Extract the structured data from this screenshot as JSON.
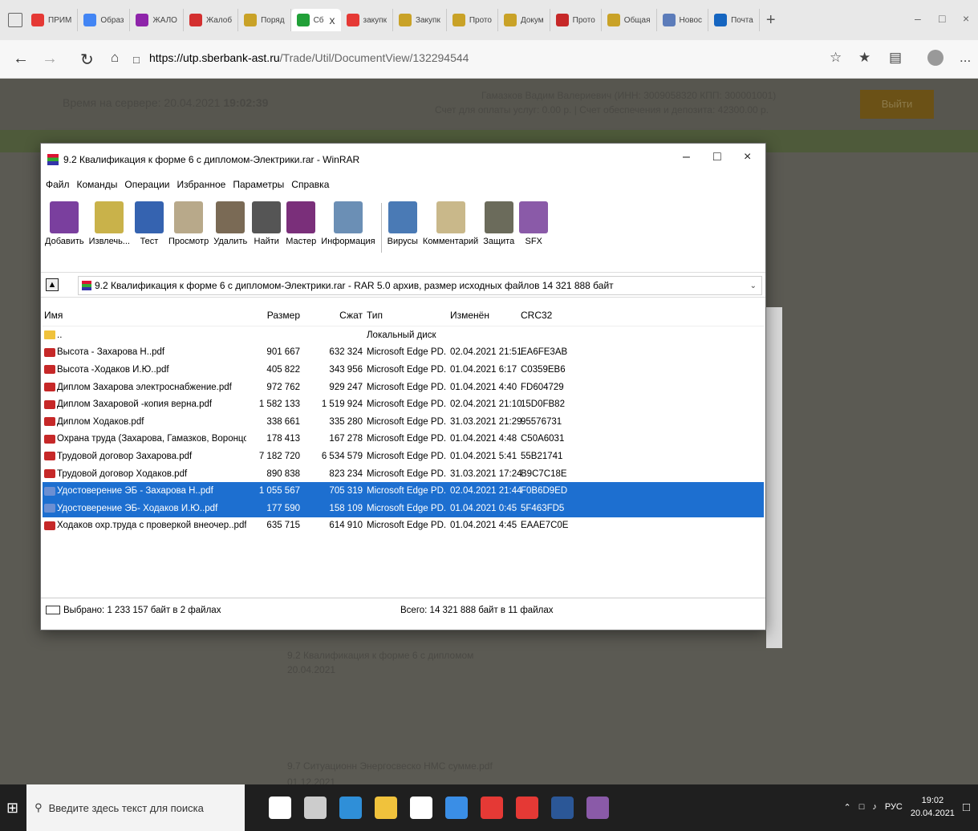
{
  "browser": {
    "tabs": [
      {
        "label": "ПРИМ",
        "favicon_color": "#e53935",
        "active": false
      },
      {
        "label": "Образ",
        "favicon_color": "#4285f4",
        "active": false
      },
      {
        "label": "ЖАЛО",
        "favicon_color": "#8e24aa",
        "active": false
      },
      {
        "label": "Жалоб",
        "favicon_color": "#d32f2f",
        "active": false
      },
      {
        "label": "Поряд",
        "favicon_color": "#c9a227",
        "active": false
      },
      {
        "label": "Сб",
        "favicon_color": "#21a038",
        "active": true,
        "close": "x"
      },
      {
        "label": "закупк",
        "favicon_color": "#e53935",
        "active": false
      },
      {
        "label": "Закупк",
        "favicon_color": "#c9a227",
        "active": false
      },
      {
        "label": "Прото",
        "favicon_color": "#c9a227",
        "active": false
      },
      {
        "label": "Докум",
        "favicon_color": "#c9a227",
        "active": false
      },
      {
        "label": "Прото",
        "favicon_color": "#c62828",
        "active": false
      },
      {
        "label": "Общая",
        "favicon_color": "#c9a227",
        "active": false
      },
      {
        "label": "Новос",
        "favicon_color": "#5c7cba",
        "active": false
      },
      {
        "label": "Почта",
        "favicon_color": "#1565c0",
        "active": false
      }
    ],
    "new_tab": "+",
    "url_scheme_host": "https://utp.sberbank-ast.ru",
    "url_path": "/Trade/Util/DocumentView/132294544",
    "more": "..."
  },
  "page_bg": {
    "server_time_label": "Время на сервере: 20.04.2021 ",
    "server_time_value": "19:02:39",
    "user_line": "Гамазков Вадим Валериевич (ИНН: 3009058320 КПП: 300001001)",
    "account_line": "Счет для оплаты услуг: 0.00 р. | Счет обеспечения и депозита: 42300.00 р.",
    "logout": "Выйти",
    "doc1_title": "9.2 Квалификация к форме 6 с дипломом",
    "doc1_date": "20.04.2021",
    "doc2_title": "9.7 Ситуационн Энергосвеско НМС сумме.pdf",
    "doc2_date": "01.12.2021"
  },
  "winrar": {
    "title": "9.2 Квалификация к форме 6 с дипломом-Электрики.rar - WinRAR",
    "menu": [
      "Файл",
      "Команды",
      "Операции",
      "Избранное",
      "Параметры",
      "Справка"
    ],
    "toolbar": [
      {
        "label": "Добавить",
        "icon": "add-archive-icon",
        "color": "#7a3f9e"
      },
      {
        "label": "Извлечь...",
        "icon": "extract-icon",
        "color": "#c9b24a"
      },
      {
        "label": "Тест",
        "icon": "test-icon",
        "color": "#3563b0"
      },
      {
        "label": "Просмотр",
        "icon": "view-icon",
        "color": "#b8a98a"
      },
      {
        "label": "Удалить",
        "icon": "delete-icon",
        "color": "#7a6a55"
      },
      {
        "label": "Найти",
        "icon": "find-icon",
        "color": "#555555"
      },
      {
        "label": "Мастер",
        "icon": "wizard-icon",
        "color": "#7a2f7a"
      },
      {
        "label": "Информация",
        "icon": "info-icon",
        "color": "#6b8fb5"
      },
      {
        "label": "Вирусы",
        "icon": "virus-scan-icon",
        "color": "#4a7ab5"
      },
      {
        "label": "Комментарий",
        "icon": "comment-icon",
        "color": "#c9b88a"
      },
      {
        "label": "Защита",
        "icon": "protect-icon",
        "color": "#6b6b5b"
      },
      {
        "label": "SFX",
        "icon": "sfx-icon",
        "color": "#8a5aa8"
      }
    ],
    "path_text": "9.2 Квалификация к форме 6 с дипломом-Электрики.rar - RAR 5.0 архив, размер исходных файлов 14 321 888 байт",
    "columns": {
      "name": "Имя",
      "size": "Размер",
      "packed": "Сжат",
      "type": "Тип",
      "modified": "Изменён",
      "crc": "CRC32"
    },
    "files": [
      {
        "name": "..",
        "size": "",
        "packed": "",
        "type": "Локальный диск",
        "modified": "",
        "crc": "",
        "kind": "folder",
        "selected": false
      },
      {
        "name": "Высота - Захарова Н..pdf",
        "size": "901 667",
        "packed": "632 324",
        "type": "Microsoft Edge PD...",
        "modified": "02.04.2021 21:51",
        "crc": "EA6FE3AB",
        "kind": "pdf",
        "selected": false
      },
      {
        "name": "Высота -Ходаков И.Ю..pdf",
        "size": "405 822",
        "packed": "343 956",
        "type": "Microsoft Edge PD...",
        "modified": "01.04.2021 6:17",
        "crc": "C0359EB6",
        "kind": "pdf",
        "selected": false
      },
      {
        "name": "Диплом Захарова электроснабжение.pdf",
        "size": "972 762",
        "packed": "929 247",
        "type": "Microsoft Edge PD...",
        "modified": "01.04.2021 4:40",
        "crc": "FD604729",
        "kind": "pdf",
        "selected": false
      },
      {
        "name": "Диплом Захаровой -копия верна.pdf",
        "size": "1 582 133",
        "packed": "1 519 924",
        "type": "Microsoft Edge PD...",
        "modified": "02.04.2021 21:10",
        "crc": "15D0FB82",
        "kind": "pdf",
        "selected": false
      },
      {
        "name": "Диплом Ходаков.pdf",
        "size": "338 661",
        "packed": "335 280",
        "type": "Microsoft Edge PD...",
        "modified": "31.03.2021 21:29",
        "crc": "95576731",
        "kind": "pdf",
        "selected": false
      },
      {
        "name": "Охрана труда (Захарова, Гамазков, Воронцо...",
        "size": "178 413",
        "packed": "167 278",
        "type": "Microsoft Edge PD...",
        "modified": "01.04.2021 4:48",
        "crc": "C50A6031",
        "kind": "pdf",
        "selected": false
      },
      {
        "name": "Трудовой договор Захарова.pdf",
        "size": "7 182 720",
        "packed": "6 534 579",
        "type": "Microsoft Edge PD...",
        "modified": "01.04.2021 5:41",
        "crc": "55B21741",
        "kind": "pdf",
        "selected": false
      },
      {
        "name": "Трудовой договор Ходаков.pdf",
        "size": "890 838",
        "packed": "823 234",
        "type": "Microsoft Edge PD...",
        "modified": "31.03.2021 17:24",
        "crc": "B9C7C18E",
        "kind": "pdf",
        "selected": false
      },
      {
        "name": "Удостоверение ЭБ - Захарова Н..pdf",
        "size": "1 055 567",
        "packed": "705 319",
        "type": "Microsoft Edge PD...",
        "modified": "02.04.2021 21:44",
        "crc": "F0B6D9ED",
        "kind": "pdf",
        "selected": true
      },
      {
        "name": "Удостоверение ЭБ- Ходаков И.Ю..pdf",
        "size": "177 590",
        "packed": "158 109",
        "type": "Microsoft Edge PD...",
        "modified": "01.04.2021 0:45",
        "crc": "5F463FD5",
        "kind": "pdf",
        "selected": true
      },
      {
        "name": "Ходаков охр.труда с проверкой внеочер..pdf",
        "size": "635 715",
        "packed": "614 910",
        "type": "Microsoft Edge PD...",
        "modified": "01.04.2021 4:45",
        "crc": "EAAE7C0E",
        "kind": "pdf",
        "selected": false
      }
    ],
    "status_left": "Выбрано: 1 233 157 байт в 2 файлах",
    "status_right": "Всего: 14 321 888 байт в 11 файлах",
    "selection_color": "#1d6fd0"
  },
  "taskbar": {
    "search_placeholder": "Введите здесь текст для поиска",
    "apps": [
      {
        "name": "cortana-icon",
        "color": "#ffffff"
      },
      {
        "name": "task-view-icon",
        "color": "#cccccc"
      },
      {
        "name": "edge-icon",
        "color": "#2f8fd8"
      },
      {
        "name": "file-explorer-icon",
        "color": "#f0c23c"
      },
      {
        "name": "store-icon",
        "color": "#ffffff"
      },
      {
        "name": "mail-icon",
        "color": "#3a8ee6"
      },
      {
        "name": "yandex-browser-icon",
        "color": "#e53935"
      },
      {
        "name": "yandex-icon",
        "color": "#e53935"
      },
      {
        "name": "word-icon",
        "color": "#2b5797"
      },
      {
        "name": "winrar-icon",
        "color": "#8a5aa8"
      }
    ],
    "lang": "РУС",
    "time": "19:02",
    "date": "20.04.2021"
  }
}
